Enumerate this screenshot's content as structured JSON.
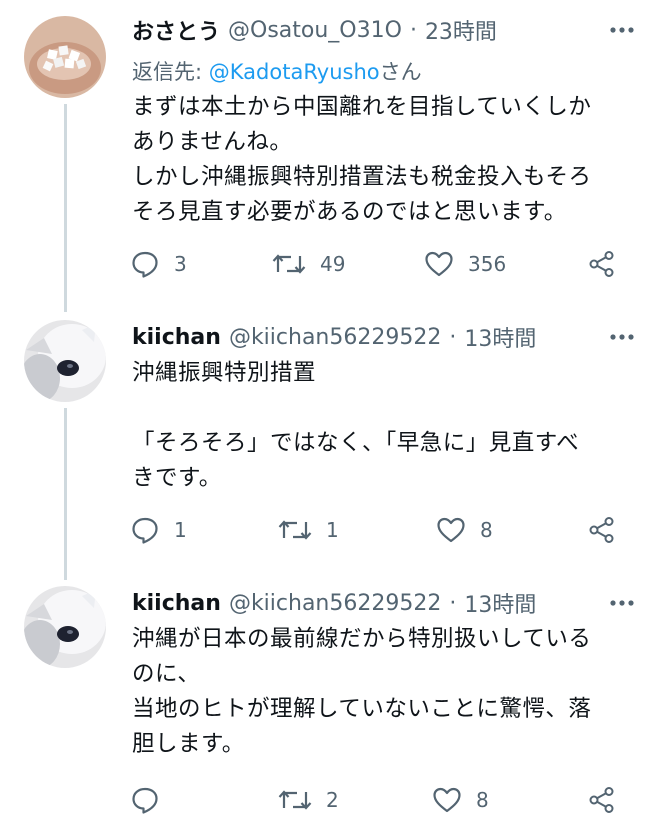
{
  "tweets": [
    {
      "display_name": "おさとう",
      "handle": "@Osatou_O31O",
      "separator": "·",
      "time": "23時間",
      "reply_prefix": "返信先: ",
      "reply_mention": "@KadotaRyusho",
      "reply_suffix": "さん",
      "text": "まずは本土から中国離れを目指していくしか\nありませんね。\nしかし沖縄振興特別措置法も税金投入もそろ\nそろ見直す必要があるのではと思います。",
      "replies": "3",
      "retweets": "49",
      "likes": "356"
    },
    {
      "display_name": "kiichan",
      "handle": "@kiichan56229522",
      "separator": "·",
      "time": "13時間",
      "text": "沖縄振興特別措置\n\n「そろそろ」ではなく、「早急に」見直すべ\nきです。",
      "replies": "1",
      "retweets": "1",
      "likes": "8"
    },
    {
      "display_name": "kiichan",
      "handle": "@kiichan56229522",
      "separator": "·",
      "time": "13時間",
      "text": "沖縄が日本の最前線だから特別扱いしている\nのに、\n当地のヒトが理解していないことに驚愕、落\n胆します。",
      "replies": "",
      "retweets": "2",
      "likes": "8"
    }
  ],
  "icons": {
    "more": "more-dots-icon",
    "reply": "reply-bubble-icon",
    "retweet": "retweet-icon",
    "like": "heart-icon",
    "share": "share-icon"
  },
  "colors": {
    "text": "#0f1419",
    "secondary": "#536471",
    "link": "#1d9bf0",
    "thread_line": "#cfd9de"
  }
}
